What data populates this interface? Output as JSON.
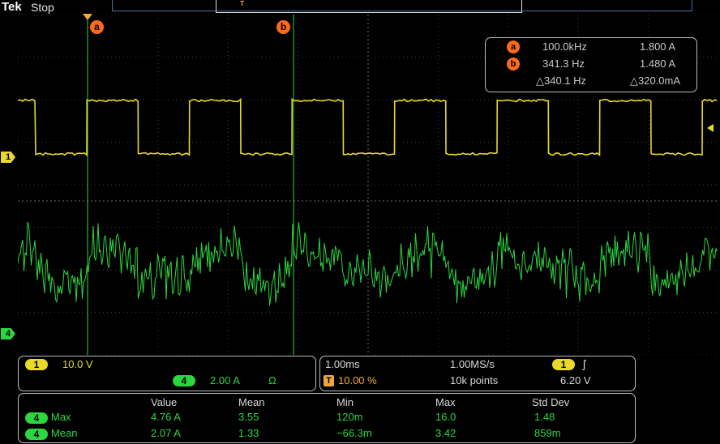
{
  "header": {
    "brand": "Tek",
    "state": "Stop"
  },
  "cursors": {
    "a_label": "a",
    "b_label": "b"
  },
  "cursor_readout": {
    "a": {
      "badge": "a",
      "freq": "100.0kHz",
      "value": "1.800 A"
    },
    "b": {
      "badge": "b",
      "freq": "341.3 Hz",
      "value": "1.480 A"
    },
    "delta": {
      "freq": "△340.1 Hz",
      "value": "△320.0mA"
    }
  },
  "channels": {
    "ch1": {
      "marker": "1",
      "color": "#e8d92a",
      "scale": "10.0 V"
    },
    "ch4": {
      "marker": "4",
      "color": "#2bd640",
      "scale": "2.00 A",
      "coupling": "Ω"
    }
  },
  "acquisition": {
    "timebase": "1.00ms",
    "sample_rate": "1.00MS/s",
    "trigger_pos_icon": "T",
    "trigger_pos": "10.00 %",
    "record_length": "10k points",
    "trigger_source": "1",
    "trigger_slope": "ʃ",
    "trigger_level": "6.20 V"
  },
  "stats_table": {
    "headers": [
      "Value",
      "Mean",
      "Min",
      "Max",
      "Std Dev"
    ],
    "rows": [
      {
        "ch": "4",
        "name": "Max",
        "value": "4.76 A",
        "mean": "3.55",
        "min": "120m",
        "max": "16.0",
        "std": "1.48"
      },
      {
        "ch": "4",
        "name": "Mean",
        "value": "2.07 A",
        "mean": "1.33",
        "min": "−66.3m",
        "max": "3.42",
        "std": "859m"
      }
    ]
  },
  "colors": {
    "accent_orange": "#ff6a1a",
    "ch1_yellow": "#e8d92a",
    "ch4_green": "#2bd640"
  },
  "icons": {
    "trigger_marker": "trigger-arrow-icon",
    "slope": "rising-edge-icon"
  }
}
